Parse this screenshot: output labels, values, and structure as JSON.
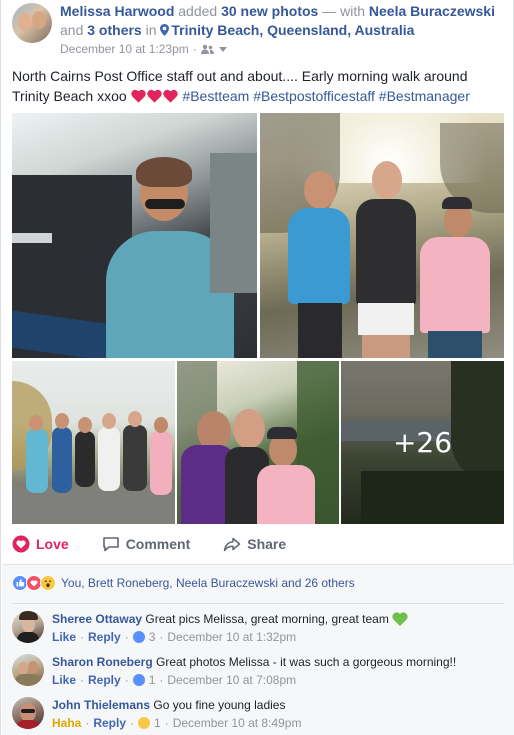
{
  "post": {
    "author": "Melissa Harwood",
    "action_text": "added",
    "photo_count_link": "30 new photos",
    "with_text": "— with",
    "tagged_person": "Neela Buraczewski",
    "and_text": "and",
    "others_link": "3 others",
    "in_text": "in",
    "location": "Trinity Beach, Queensland, Australia",
    "timestamp": "December 10 at 1:23pm",
    "separator": "·",
    "message": "North Cairns Post Office staff out and about.... Early morning walk around Trinity Beach xxoo",
    "hashtags": "#Bestteam #Bestpostofficestaff #Bestmanager",
    "more_photos_label": "+26"
  },
  "actions": {
    "love_label": "Love",
    "comment_label": "Comment",
    "share_label": "Share"
  },
  "reactions": {
    "summary": "You, Brett Roneberg, Neela Buraczewski and 26 others"
  },
  "comments": [
    {
      "name": "Sheree Ottaway",
      "text": "Great pics Melissa, great morning, great team",
      "reaction": "Like",
      "reply": "Reply",
      "count": "3",
      "time": "December 10 at 1:32pm"
    },
    {
      "name": "Sharon Roneberg",
      "text": "Great photos Melissa - it was such a gorgeous morning!!",
      "reaction": "Like",
      "reply": "Reply",
      "count": "1",
      "time": "December 10 at 7:08pm"
    },
    {
      "name": "John Thielemans",
      "text": "Go you fine young ladies",
      "reaction": "Haha",
      "reply": "Reply",
      "count": "1",
      "time": "December 10 at 8:49pm"
    }
  ],
  "colors": {
    "link": "#365899",
    "love": "#e0245e",
    "meta": "#90949c"
  }
}
